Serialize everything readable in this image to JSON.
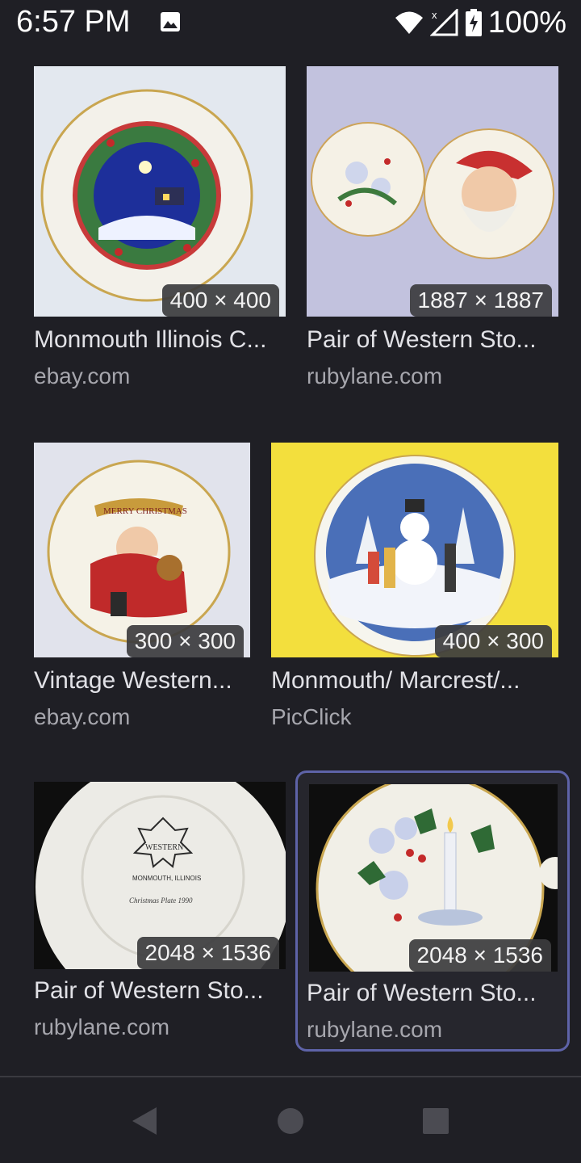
{
  "status_bar": {
    "time": "6:57 PM",
    "battery": "100%",
    "icons": [
      "gallery-icon",
      "wifi-icon",
      "no-signal-icon",
      "battery-charging-icon"
    ]
  },
  "results": [
    {
      "dimensions": "400 × 400",
      "title": "Monmouth Illinois C...",
      "source": "ebay.com",
      "image": "christmas-wreath-plate"
    },
    {
      "dimensions": "1887 × 1887",
      "title": "Pair of Western Sto...",
      "source": "rubylane.com",
      "image": "poinsettia-and-santa-plates"
    },
    {
      "dimensions": "300 × 300",
      "title": "Vintage Western...",
      "source": "ebay.com",
      "image": "merry-christmas-santa-plate"
    },
    {
      "dimensions": "400 × 300",
      "title": "Monmouth/ Marcrest/...",
      "source": "PicClick",
      "image": "snowman-plate-yellow-background"
    },
    {
      "dimensions": "2048 × 1536",
      "title": "Pair of Western Sto...",
      "source": "rubylane.com",
      "image": "plate-backstamp"
    },
    {
      "dimensions": "2048 × 1536",
      "title": "Pair of Western Sto...",
      "source": "rubylane.com",
      "image": "holly-candle-plate"
    }
  ],
  "nav_bar": {
    "icons": [
      "back-icon",
      "home-icon",
      "recents-icon"
    ]
  },
  "colors": {
    "background": "#1f1f25",
    "selection_border": "#5e63a8",
    "source_text": "#a6a6ad"
  }
}
